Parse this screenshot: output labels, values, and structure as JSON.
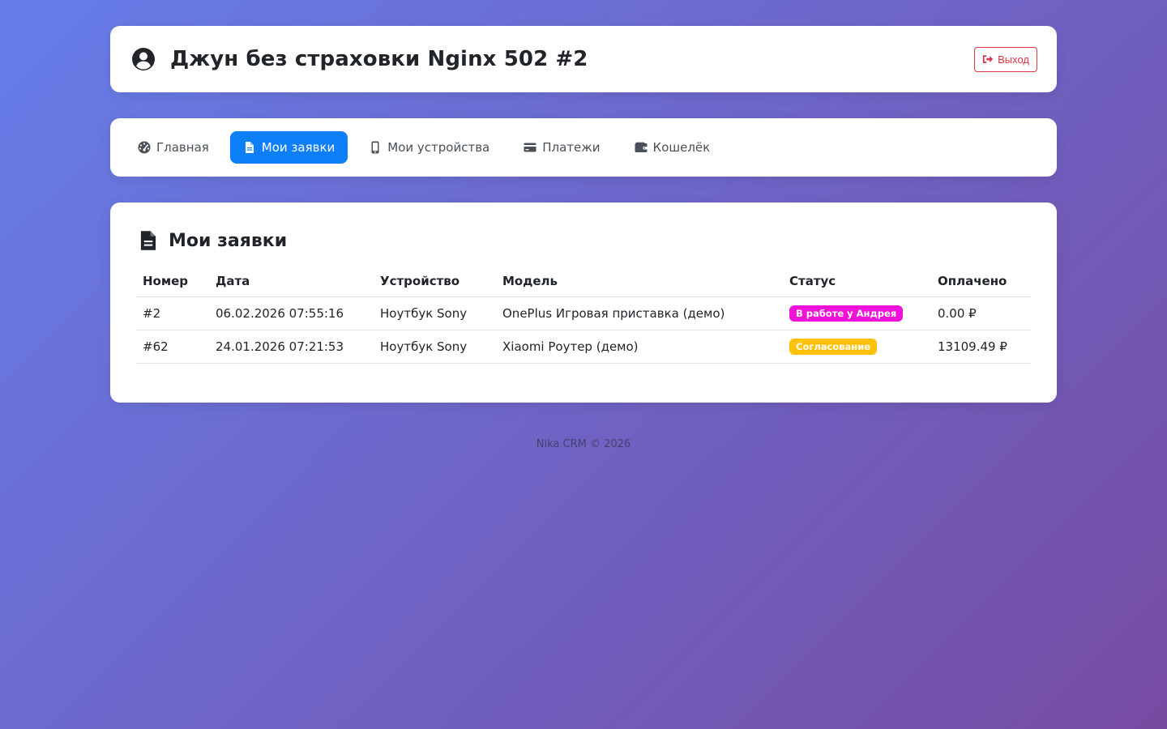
{
  "header": {
    "title": "Джун без страховки Nginx 502 #2",
    "logout_label": "Выход",
    "user_icon": "user-circle-icon",
    "logout_icon": "sign-out-icon"
  },
  "nav": {
    "items": [
      {
        "label": "Главная",
        "icon": "dashboard-icon",
        "active": false
      },
      {
        "label": "Мои заявки",
        "icon": "file-icon",
        "active": true
      },
      {
        "label": "Мои устройства",
        "icon": "mobile-icon",
        "active": false
      },
      {
        "label": "Платежи",
        "icon": "credit-card-icon",
        "active": false
      },
      {
        "label": "Кошелёк",
        "icon": "wallet-icon",
        "active": false
      }
    ],
    "active_color": "#0d7ff9"
  },
  "orders": {
    "title": "Мои заявки",
    "columns": [
      "Номер",
      "Дата",
      "Устройство",
      "Модель",
      "Статус",
      "Оплачено"
    ],
    "rows": [
      {
        "number": "#2",
        "date": "06.02.2026 07:55:16",
        "device": "Ноутбук Sony",
        "model": "OnePlus Игровая приставка (демо)",
        "status": "В работе у Андрея",
        "status_color": "#f012d8",
        "paid": "0.00 ₽"
      },
      {
        "number": "#62",
        "date": "24.01.2026 07:21:53",
        "device": "Ноутбук Sony",
        "model": "Xiaomi Роутер (демо)",
        "status": "Согласование",
        "status_color": "#ffc107",
        "paid": "13109.49 ₽"
      }
    ]
  },
  "footer": {
    "text": "Nika CRM © 2026"
  }
}
